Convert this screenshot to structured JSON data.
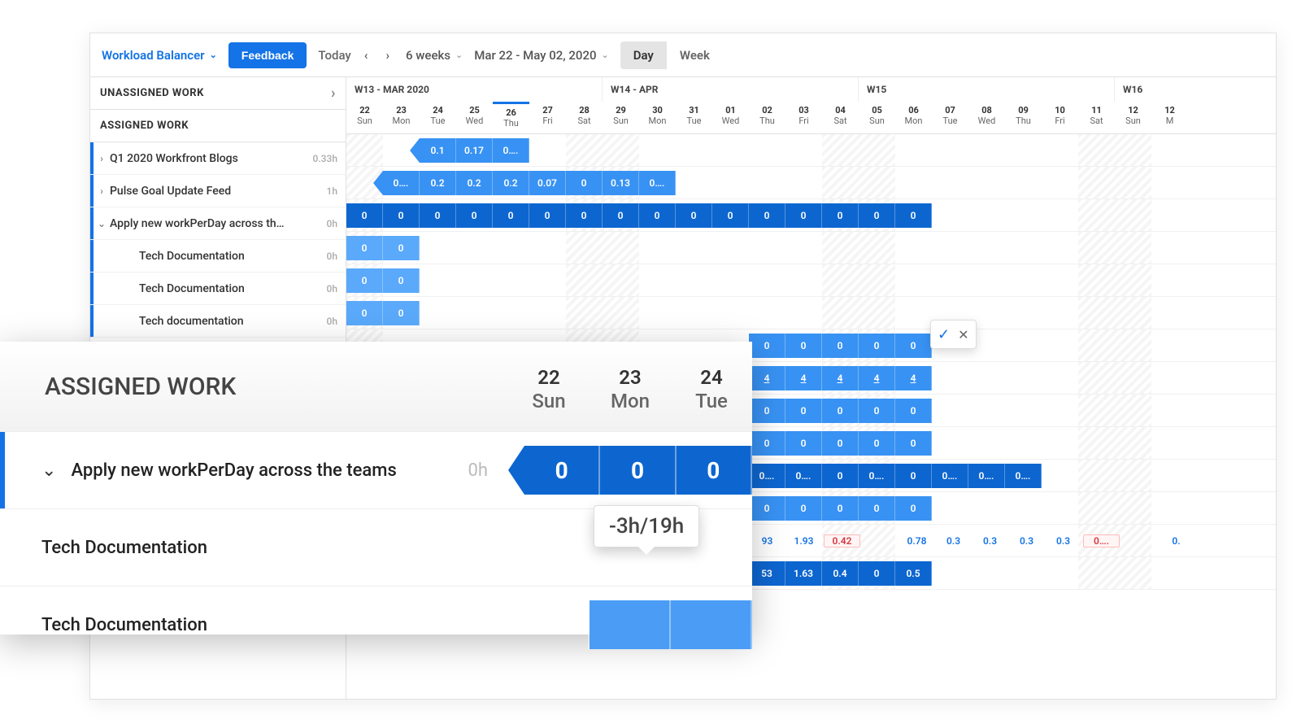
{
  "header": {
    "title": "Workload Balancer",
    "feedback": "Feedback",
    "today": "Today",
    "range": "6 weeks",
    "dateRange": "Mar 22 - May 02, 2020",
    "day": "Day",
    "week": "Week"
  },
  "sections": {
    "unassigned": "UNASSIGNED WORK",
    "assigned": "ASSIGNED WORK"
  },
  "weeks": [
    {
      "label": "W13 - MAR 2020"
    },
    {
      "label": "W14 - APR"
    },
    {
      "label": "W15"
    },
    {
      "label": "W16"
    }
  ],
  "days": [
    {
      "n": "22",
      "d": "Sun",
      "wk": true
    },
    {
      "n": "23",
      "d": "Mon"
    },
    {
      "n": "24",
      "d": "Tue"
    },
    {
      "n": "25",
      "d": "Wed"
    },
    {
      "n": "26",
      "d": "Thu",
      "today": true
    },
    {
      "n": "27",
      "d": "Fri"
    },
    {
      "n": "28",
      "d": "Sat",
      "wk": true
    },
    {
      "n": "29",
      "d": "Sun",
      "wk": true
    },
    {
      "n": "30",
      "d": "Mon"
    },
    {
      "n": "31",
      "d": "Tue"
    },
    {
      "n": "01",
      "d": "Wed"
    },
    {
      "n": "02",
      "d": "Thu"
    },
    {
      "n": "03",
      "d": "Fri"
    },
    {
      "n": "04",
      "d": "Sat",
      "wk": true
    },
    {
      "n": "05",
      "d": "Sun",
      "wk": true
    },
    {
      "n": "06",
      "d": "Mon"
    },
    {
      "n": "07",
      "d": "Tue"
    },
    {
      "n": "08",
      "d": "Wed"
    },
    {
      "n": "09",
      "d": "Thu"
    },
    {
      "n": "10",
      "d": "Fri"
    },
    {
      "n": "11",
      "d": "Sat",
      "wk": true
    },
    {
      "n": "12",
      "d": "Sun",
      "wk": true
    },
    {
      "n": "12",
      "d": "M"
    }
  ],
  "tasks": [
    {
      "label": "Q1 2020 Workfront Blogs",
      "hours": "0.33h",
      "toggle": "›",
      "start": 2,
      "cls": "med",
      "arrow": true,
      "values": [
        "0.1",
        "0.17",
        "0…."
      ]
    },
    {
      "label": "Pulse Goal Update Feed",
      "hours": "1h",
      "toggle": "›",
      "start": 1,
      "cls": "med",
      "arrow": true,
      "values": [
        "0….",
        "0.2",
        "0.2",
        "0.2",
        "0.07",
        "0",
        "0.13",
        "0…."
      ]
    },
    {
      "label": "Apply new workPerDay across th…",
      "hours": "0h",
      "toggle": "⌄",
      "start": 0,
      "cls": "dark",
      "arrow": true,
      "values": [
        "0",
        "0",
        "0",
        "0",
        "0",
        "0",
        "0",
        "0",
        "0",
        "0",
        "0",
        "0",
        "0",
        "0",
        "0",
        "0"
      ]
    },
    {
      "label": "Tech Documentation",
      "hours": "0h",
      "toggle": "",
      "indent": true,
      "start": 0,
      "cls": "light",
      "arrow": true,
      "values": [
        "0",
        "0"
      ]
    },
    {
      "label": "Tech Documentation",
      "hours": "0h",
      "toggle": "",
      "indent": true,
      "start": 0,
      "cls": "light",
      "arrow": true,
      "values": [
        "0",
        "0"
      ]
    },
    {
      "label": "Tech documentation",
      "hours": "0h",
      "toggle": "",
      "indent": true,
      "start": 0,
      "cls": "light",
      "arrow": true,
      "values": [
        "0",
        "0"
      ]
    }
  ],
  "extra_rows": [
    {
      "start": 11,
      "cls": "med",
      "values": [
        "0",
        "0",
        "0",
        "0",
        "0"
      ]
    },
    {
      "start": 11,
      "cls": "med",
      "underline": true,
      "values": [
        "4",
        "4",
        "4",
        "4",
        "4"
      ]
    },
    {
      "start": 11,
      "cls": "med",
      "values": [
        "0",
        "0",
        "0",
        "0",
        "0"
      ]
    },
    {
      "start": 11,
      "cls": "med",
      "values": [
        "0",
        "0",
        "0",
        "0",
        "0"
      ]
    },
    {
      "start": 11,
      "cls": "dark",
      "values": [
        "0….",
        "0….",
        "0",
        "0….",
        "0",
        "0….",
        "0….",
        "0…."
      ]
    },
    {
      "start": 11,
      "cls": "med",
      "values": [
        "0",
        "0",
        "0",
        "0",
        "0"
      ]
    },
    {
      "start": 11,
      "cls": "dark",
      "values": [
        "53",
        "1.63",
        "0.4",
        "0",
        "0.5"
      ]
    }
  ],
  "summary_row": {
    "start": 11,
    "cells": [
      {
        "v": "93",
        "c": "blue"
      },
      {
        "v": "1.93",
        "c": "blue"
      },
      {
        "v": "0.42",
        "c": "red"
      },
      {
        "v": "",
        "c": ""
      },
      {
        "v": "0.78",
        "c": "blue"
      },
      {
        "v": "0.3",
        "c": "blue"
      },
      {
        "v": "0.3",
        "c": "blue"
      },
      {
        "v": "0.3",
        "c": "blue"
      },
      {
        "v": "0.3",
        "c": "blue"
      },
      {
        "v": "0….",
        "c": "red"
      },
      {
        "v": "",
        "c": ""
      },
      {
        "v": "0.",
        "c": "blue"
      }
    ]
  },
  "zoom": {
    "title": "ASSIGNED WORK",
    "days": [
      {
        "n": "22",
        "d": "Sun"
      },
      {
        "n": "23",
        "d": "Mon"
      },
      {
        "n": "24",
        "d": "Tue"
      }
    ],
    "rows": [
      {
        "label": "Apply new workPerDay across the teams",
        "hours": "0h",
        "chev": "⌄",
        "accent": true,
        "cells": [
          "0",
          "0",
          "0"
        ],
        "cls": "dark",
        "arrow": true
      },
      {
        "label": "Tech Documentation",
        "hours": "",
        "chev": "",
        "accent": false,
        "tooltip": "-3h/19h",
        "cells": [
          "",
          "",
          ""
        ],
        "cls": "none"
      },
      {
        "label": "Tech Documentation",
        "hours": "",
        "chev": "",
        "accent": false,
        "cells": [
          "",
          "",
          ""
        ],
        "cls": "med",
        "from": 1
      }
    ],
    "tooltip": "-3h/19h"
  },
  "icons": {
    "check": "✓",
    "close": "✕"
  }
}
